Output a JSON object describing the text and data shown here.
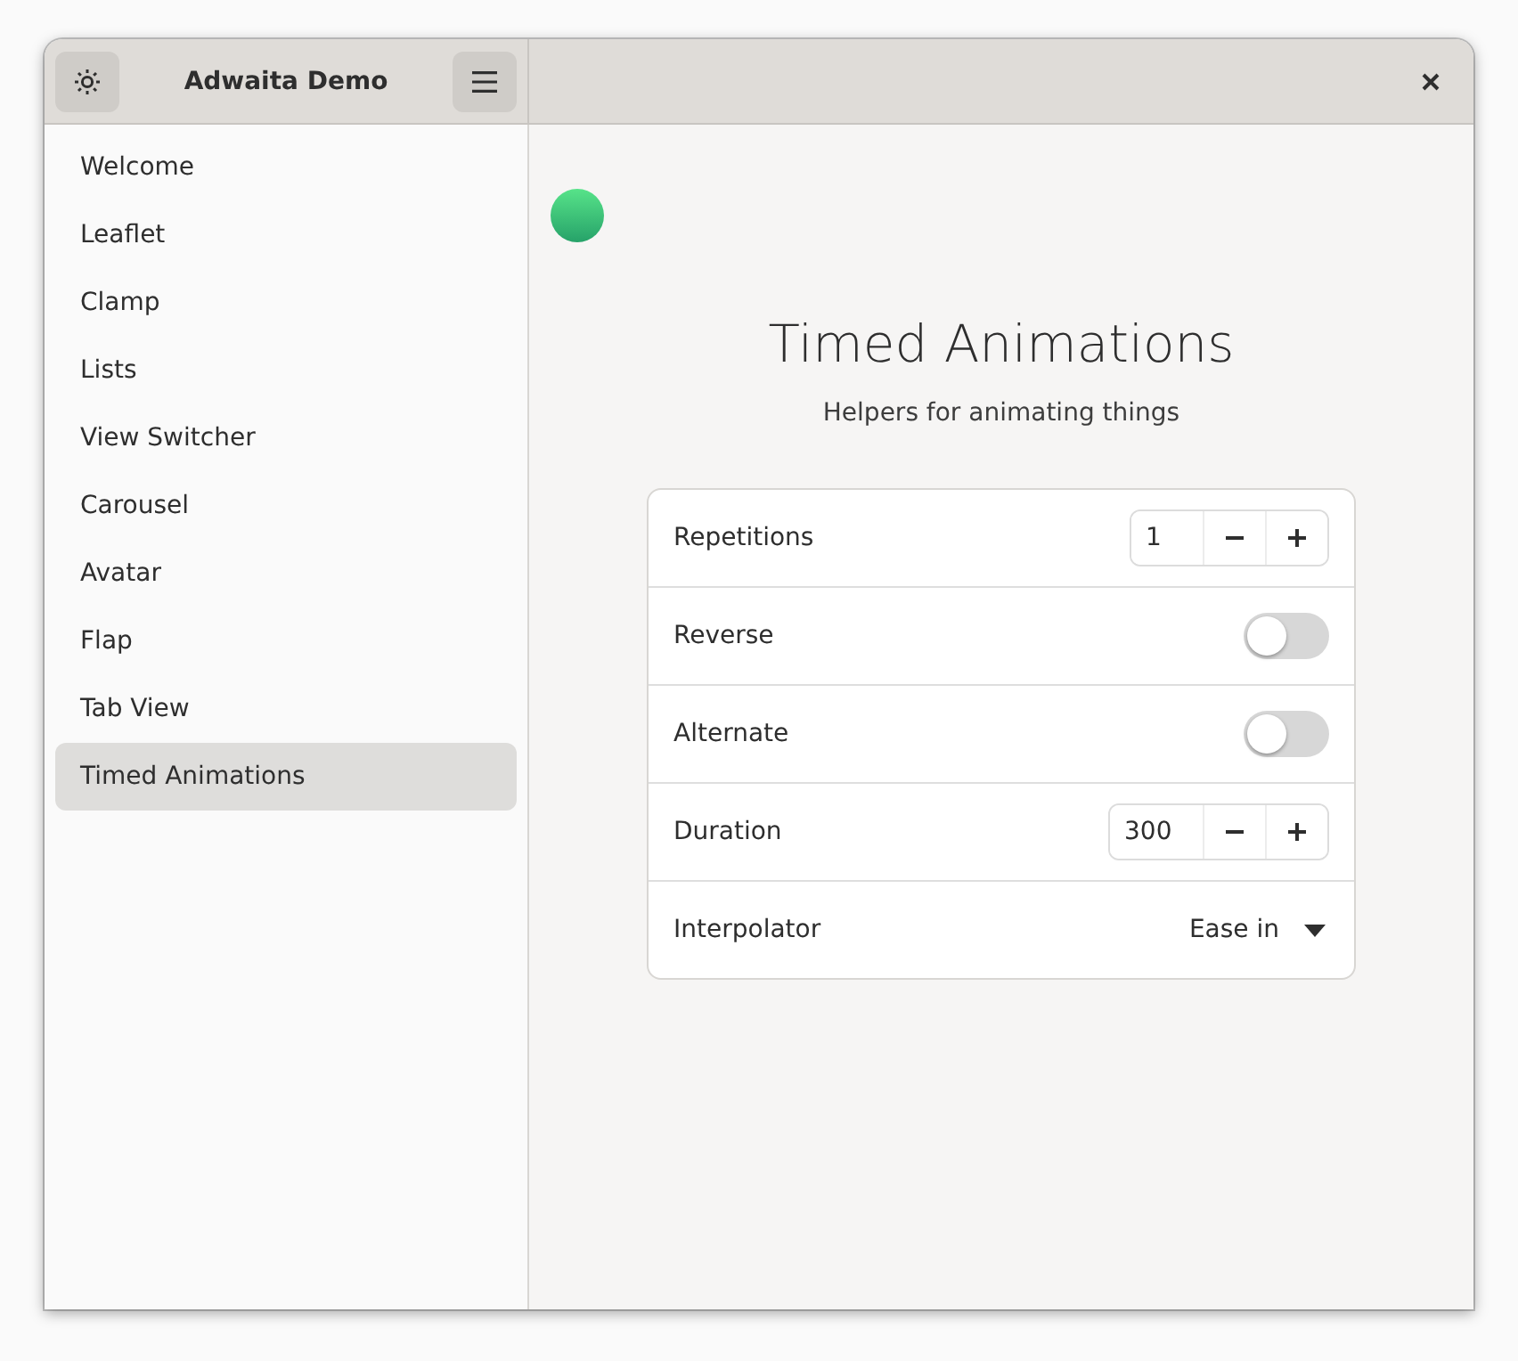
{
  "window": {
    "title": "Adwaita Demo"
  },
  "sidebar": {
    "items": [
      {
        "label": "Welcome",
        "selected": false
      },
      {
        "label": "Leaflet",
        "selected": false
      },
      {
        "label": "Clamp",
        "selected": false
      },
      {
        "label": "Lists",
        "selected": false
      },
      {
        "label": "View Switcher",
        "selected": false
      },
      {
        "label": "Carousel",
        "selected": false
      },
      {
        "label": "Avatar",
        "selected": false
      },
      {
        "label": "Flap",
        "selected": false
      },
      {
        "label": "Tab View",
        "selected": false
      },
      {
        "label": "Timed Animations",
        "selected": true
      }
    ]
  },
  "page": {
    "title": "Timed Animations",
    "subtitle": "Helpers for animating things",
    "rows": [
      {
        "kind": "spin",
        "label": "Repetitions",
        "value": "1"
      },
      {
        "kind": "switch",
        "label": "Reverse",
        "on": false
      },
      {
        "kind": "switch",
        "label": "Alternate",
        "on": false
      },
      {
        "kind": "spin",
        "label": "Duration",
        "value": "300"
      },
      {
        "kind": "dropdown",
        "label": "Interpolator",
        "value": "Ease in"
      }
    ]
  }
}
